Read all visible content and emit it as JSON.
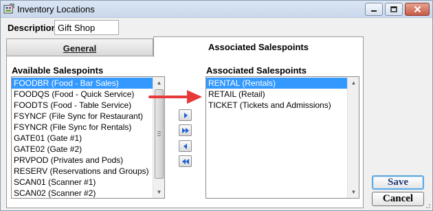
{
  "window": {
    "title": "Inventory Locations",
    "icons": {
      "app": "app-icon",
      "minimize": "minimize-icon",
      "maximize": "maximize-icon",
      "close": "close-icon"
    }
  },
  "description": {
    "label": "Description",
    "value": "Gift Shop"
  },
  "tabs": {
    "general": "General",
    "associated": "Associated Salespoints",
    "active": "associated"
  },
  "available": {
    "title": "Available Salespoints",
    "items": [
      "FOODBR  (Food - Bar Sales)",
      "FOODQS  (Food - Quick Service)",
      "FOODTS  (Food - Table Service)",
      "FSYNCF  (File Sync for Restaurant)",
      "FSYNCR  (File Sync for Rentals)",
      "GATE01  (Gate #1)",
      "GATE02  (Gate #2)",
      "PRVPOD  (Privates and Pods)",
      "RESERV  (Reservations and Groups)",
      "SCAN01  (Scanner #1)",
      "SCAN02  (Scanner #2)"
    ],
    "selected_index": 0
  },
  "associated": {
    "title": "Associated Salespoints",
    "items": [
      "RENTAL  (Rentals)",
      "RETAIL  (Retail)",
      "TICKET  (Tickets and Admissions)"
    ],
    "selected_index": 0
  },
  "transfer_buttons": [
    "move-right-icon",
    "move-all-right-icon",
    "move-left-icon",
    "move-all-left-icon"
  ],
  "actions": {
    "save": "Save",
    "cancel": "Cancel"
  },
  "colors": {
    "selection": "#3399ff",
    "annotation_arrow": "#e8393a",
    "button_text": "#1f3a7a",
    "transfer_arrow": "#1e5fd6"
  }
}
